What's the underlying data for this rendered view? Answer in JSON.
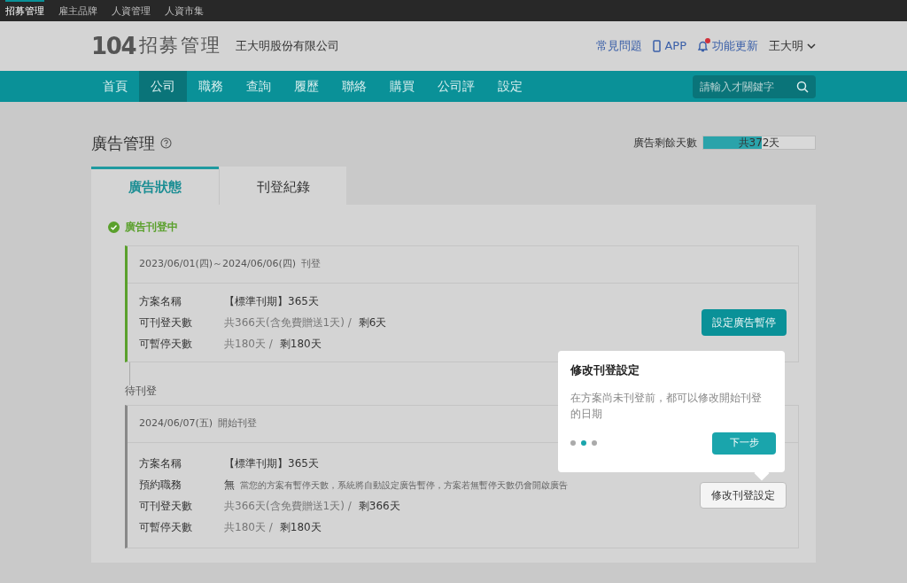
{
  "top_bar": {
    "items": [
      {
        "label": "招募管理",
        "selected": true
      },
      {
        "label": "雇主品牌",
        "selected": false
      },
      {
        "label": "人資管理",
        "selected": false
      },
      {
        "label": "人資市集",
        "selected": false
      }
    ]
  },
  "header": {
    "logo_number": "104",
    "logo_text": "招募管理",
    "company": "王大明股份有限公司",
    "links": [
      {
        "kind": "text",
        "label": "常見問題"
      },
      {
        "kind": "app",
        "label": "APP"
      },
      {
        "kind": "bell",
        "label": "功能更新",
        "badge": true
      },
      {
        "kind": "user",
        "label": "王大明"
      }
    ]
  },
  "nav": {
    "items": [
      {
        "label": "首頁",
        "selected": false
      },
      {
        "label": "公司",
        "selected": true
      },
      {
        "label": "職務",
        "selected": false
      },
      {
        "label": "查詢",
        "selected": false
      },
      {
        "label": "履歷",
        "selected": false
      },
      {
        "label": "聯絡",
        "selected": false
      },
      {
        "label": "購買",
        "selected": false
      },
      {
        "label": "公司評",
        "selected": false
      },
      {
        "label": "設定",
        "selected": false
      }
    ],
    "search": {
      "placeholder": "請輸入才關鍵字"
    }
  },
  "page": {
    "title": "廣告管理",
    "remaining": {
      "label": "廣告剩餘天數",
      "value": "共372天",
      "level": 0.52
    }
  },
  "tabs": [
    {
      "label": "廣告狀態",
      "selected": true
    },
    {
      "label": "刊登紀錄",
      "selected": false
    }
  ],
  "status": "廣告刊登中",
  "cards": [
    {
      "kind": "active",
      "date": "2023/06/01(四)～2024/06/06(四)",
      "note": "刊登",
      "button": {
        "label": "設定廣告暫停",
        "kind": "primary"
      },
      "rows": [
        {
          "kind": "plan",
          "label": "方案名稱",
          "value": "【標準刊期】365天"
        },
        {
          "kind": "days",
          "label": "可刊登天數",
          "total": "共366天(含免費贈送1天) /",
          "remaining": "剩6天"
        },
        {
          "kind": "days",
          "label": "可暫停天數",
          "total": "共180天 /",
          "remaining": "剩180天"
        }
      ]
    },
    {
      "kind": "pending",
      "section_label": "待刊登",
      "date": "2024/06/07(五)",
      "note": "開始刊登",
      "button": {
        "label": "修改刊登設定",
        "kind": "outline"
      },
      "rows": [
        {
          "kind": "plan",
          "label": "方案名稱",
          "value": "【標準刊期】365天"
        },
        {
          "kind": "reserve",
          "label": "預約職務",
          "value": "無",
          "note": "當您的方案有暫停天數，系統將自動設定廣告暫停，方案若無暫停天數仍會開啟廣告"
        },
        {
          "kind": "days",
          "label": "可刊登天數",
          "total": "共366天(含免費贈送1天) /",
          "remaining": "剩366天"
        },
        {
          "kind": "days",
          "label": "可暫停天數",
          "total": "共180天 /",
          "remaining": "剩180天"
        }
      ]
    }
  ],
  "tooltip": {
    "title": "修改刊登設定",
    "body": "在方案尚未刊登前，都可以修改開始刊登的日期",
    "steps": [
      {
        "selected": false
      },
      {
        "selected": true
      },
      {
        "selected": false
      }
    ],
    "button": "下一步"
  }
}
